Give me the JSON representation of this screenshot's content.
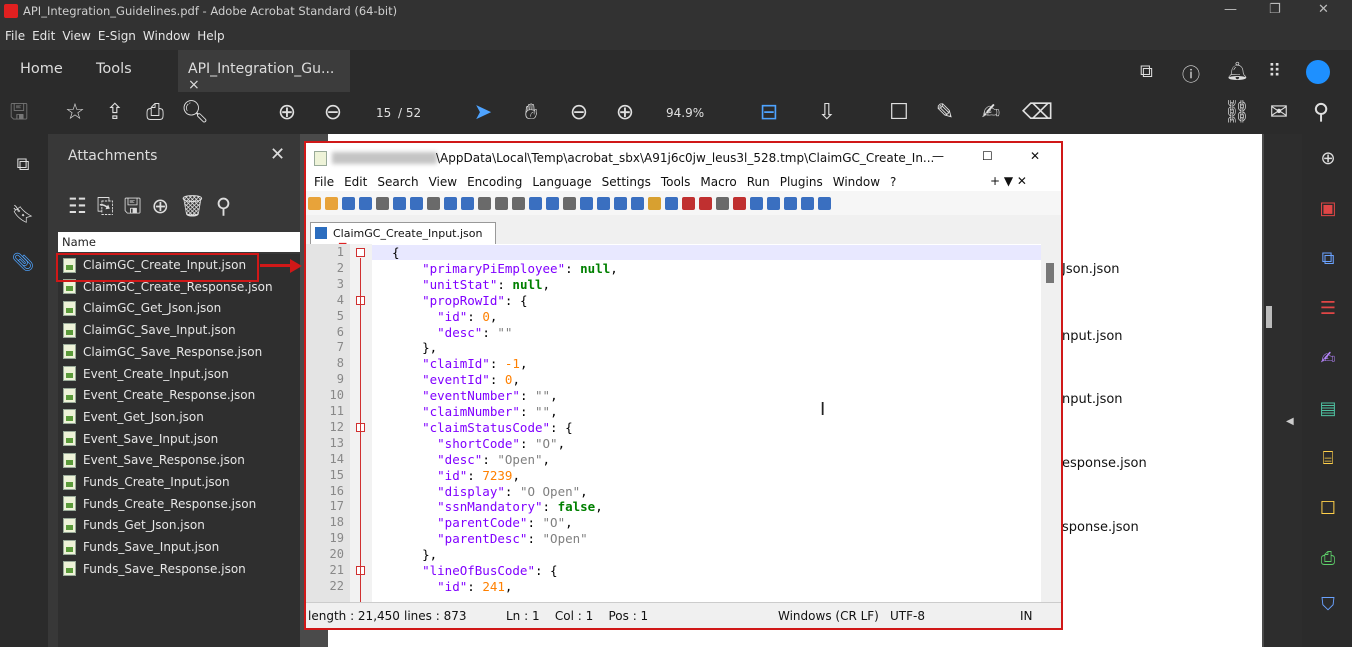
{
  "app": {
    "title": "API_Integration_Guidelines.pdf - Adobe Acrobat Standard (64-bit)",
    "menu": [
      "File",
      "Edit",
      "View",
      "E-Sign",
      "Window",
      "Help"
    ],
    "tabs": {
      "home": "Home",
      "tools": "Tools",
      "doc": "API_Integration_Gu... ×"
    },
    "page_current": "15",
    "page_total": "/ 52",
    "zoom": "94.9%"
  },
  "attachments": {
    "title": "Attachments",
    "column": "Name",
    "files": [
      "ClaimGC_Create_Input.json",
      "ClaimGC_Create_Response.json",
      "ClaimGC_Get_Json.json",
      "ClaimGC_Save_Input.json",
      "ClaimGC_Save_Response.json",
      "Event_Create_Input.json",
      "Event_Create_Response.json",
      "Event_Get_Json.json",
      "Event_Save_Input.json",
      "Event_Save_Response.json",
      "Funds_Create_Input.json",
      "Funds_Create_Response.json",
      "Funds_Get_Json.json",
      "Funds_Save_Input.json",
      "Funds_Save_Response.json"
    ]
  },
  "page_fragments": [
    "Json.json",
    "nput.json",
    "nput.json",
    "esponse.json",
    "sponse.json"
  ],
  "notepad": {
    "title_path": "\\AppData\\Local\\Temp\\acrobat_sbx\\A91j6c0jw_leus3l_528.tmp\\ClaimGC_Create_In...",
    "menu": [
      "File",
      "Edit",
      "Search",
      "View",
      "Encoding",
      "Language",
      "Settings",
      "Tools",
      "Macro",
      "Run",
      "Plugins",
      "Window",
      "?"
    ],
    "menu_right": "+ ▼ ✕",
    "tab": "ClaimGC_Create_Input.json",
    "lines": [
      {
        "n": "1",
        "t": [
          [
            "p",
            "{"
          ]
        ]
      },
      {
        "n": "2",
        "t": [
          [
            "k",
            "    \"primaryPiEmployee\""
          ],
          [
            "p",
            ": "
          ],
          [
            "b",
            "null"
          ],
          [
            "p",
            ","
          ]
        ]
      },
      {
        "n": "3",
        "t": [
          [
            "k",
            "    \"unitStat\""
          ],
          [
            "p",
            ": "
          ],
          [
            "b",
            "null"
          ],
          [
            "p",
            ","
          ]
        ]
      },
      {
        "n": "4",
        "t": [
          [
            "k",
            "    \"propRowId\""
          ],
          [
            "p",
            ": {"
          ]
        ]
      },
      {
        "n": "5",
        "t": [
          [
            "k",
            "      \"id\""
          ],
          [
            "p",
            ": "
          ],
          [
            "n",
            "0"
          ],
          [
            "p",
            ","
          ]
        ]
      },
      {
        "n": "6",
        "t": [
          [
            "k",
            "      \"desc\""
          ],
          [
            "p",
            ": "
          ],
          [
            "s",
            "\"\""
          ]
        ]
      },
      {
        "n": "7",
        "t": [
          [
            "p",
            "    },"
          ]
        ]
      },
      {
        "n": "8",
        "t": [
          [
            "k",
            "    \"claimId\""
          ],
          [
            "p",
            ": "
          ],
          [
            "n",
            "-1"
          ],
          [
            "p",
            ","
          ]
        ]
      },
      {
        "n": "9",
        "t": [
          [
            "k",
            "    \"eventId\""
          ],
          [
            "p",
            ": "
          ],
          [
            "n",
            "0"
          ],
          [
            "p",
            ","
          ]
        ]
      },
      {
        "n": "10",
        "t": [
          [
            "k",
            "    \"eventNumber\""
          ],
          [
            "p",
            ": "
          ],
          [
            "s",
            "\"\""
          ],
          [
            "p",
            ","
          ]
        ]
      },
      {
        "n": "11",
        "t": [
          [
            "k",
            "    \"claimNumber\""
          ],
          [
            "p",
            ": "
          ],
          [
            "s",
            "\"\""
          ],
          [
            "p",
            ","
          ]
        ]
      },
      {
        "n": "12",
        "t": [
          [
            "k",
            "    \"claimStatusCode\""
          ],
          [
            "p",
            ": {"
          ]
        ]
      },
      {
        "n": "13",
        "t": [
          [
            "k",
            "      \"shortCode\""
          ],
          [
            "p",
            ": "
          ],
          [
            "s",
            "\"O\""
          ],
          [
            "p",
            ","
          ]
        ]
      },
      {
        "n": "14",
        "t": [
          [
            "k",
            "      \"desc\""
          ],
          [
            "p",
            ": "
          ],
          [
            "s",
            "\"Open\""
          ],
          [
            "p",
            ","
          ]
        ]
      },
      {
        "n": "15",
        "t": [
          [
            "k",
            "      \"id\""
          ],
          [
            "p",
            ": "
          ],
          [
            "n",
            "7239"
          ],
          [
            "p",
            ","
          ]
        ]
      },
      {
        "n": "16",
        "t": [
          [
            "k",
            "      \"display\""
          ],
          [
            "p",
            ": "
          ],
          [
            "s",
            "\"O Open\""
          ],
          [
            "p",
            ","
          ]
        ]
      },
      {
        "n": "17",
        "t": [
          [
            "k",
            "      \"ssnMandatory\""
          ],
          [
            "p",
            ": "
          ],
          [
            "b",
            "false"
          ],
          [
            "p",
            ","
          ]
        ]
      },
      {
        "n": "18",
        "t": [
          [
            "k",
            "      \"parentCode\""
          ],
          [
            "p",
            ": "
          ],
          [
            "s",
            "\"O\""
          ],
          [
            "p",
            ","
          ]
        ]
      },
      {
        "n": "19",
        "t": [
          [
            "k",
            "      \"parentDesc\""
          ],
          [
            "p",
            ": "
          ],
          [
            "s",
            "\"Open\""
          ]
        ]
      },
      {
        "n": "20",
        "t": [
          [
            "p",
            "    },"
          ]
        ]
      },
      {
        "n": "21",
        "t": [
          [
            "k",
            "    \"lineOfBusCode\""
          ],
          [
            "p",
            ": {"
          ]
        ]
      },
      {
        "n": "22",
        "t": [
          [
            "k",
            "      \"id\""
          ],
          [
            "p",
            ": "
          ],
          [
            "n",
            "241"
          ],
          [
            "p",
            ","
          ]
        ]
      }
    ],
    "status": {
      "length": "length : 21,450",
      "lines": "lines : 873",
      "pos": "Ln : 1    Col : 1    Pos : 1",
      "eol": "Windows (CR LF)",
      "enc": "UTF-8",
      "mode": "IN"
    }
  }
}
